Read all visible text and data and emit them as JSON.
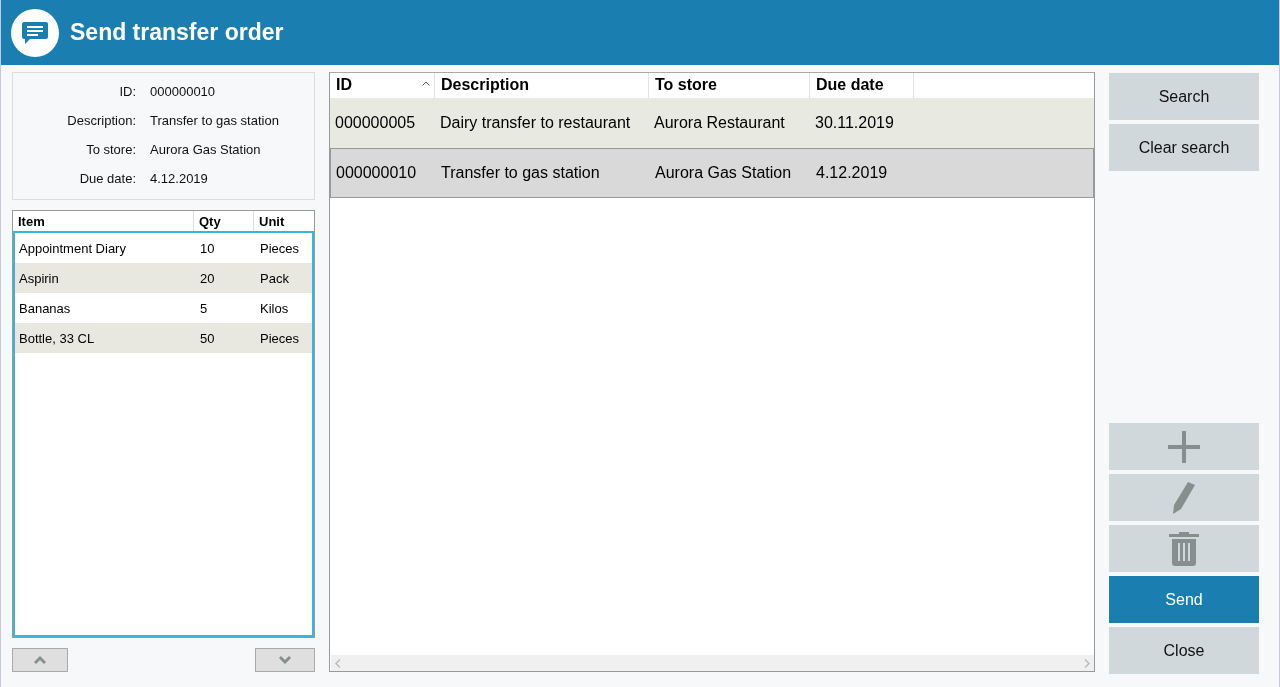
{
  "window": {
    "title": "Send transfer order"
  },
  "details": [
    {
      "label": "ID:",
      "value": "000000010"
    },
    {
      "label": "Description:",
      "value": "Transfer to gas station"
    },
    {
      "label": "To store:",
      "value": "Aurora Gas Station"
    },
    {
      "label": "Due date:",
      "value": "4.12.2019"
    }
  ],
  "items": {
    "columns": [
      "Item",
      "Qty",
      "Unit"
    ],
    "rows": [
      [
        "Appointment Diary",
        "10",
        "Pieces"
      ],
      [
        "Aspirin",
        "20",
        "Pack"
      ],
      [
        "Bananas",
        "5",
        "Kilos"
      ],
      [
        "Bottle, 33 CL",
        "50",
        "Pieces"
      ]
    ]
  },
  "orders": {
    "columns": [
      {
        "label": "ID",
        "sorted": true
      },
      {
        "label": "Description",
        "sorted": false
      },
      {
        "label": "To store",
        "sorted": false
      },
      {
        "label": "Due date",
        "sorted": false
      }
    ],
    "rows": [
      {
        "cells": [
          "000000005",
          "Dairy transfer to restaurant",
          "Aurora Restaurant",
          "30.11.2019"
        ],
        "selected": false
      },
      {
        "cells": [
          "000000010",
          "Transfer to gas station",
          "Aurora Gas Station",
          "4.12.2019"
        ],
        "selected": true
      }
    ]
  },
  "actions": [
    {
      "kind": "text",
      "label": "Search"
    },
    {
      "kind": "text",
      "label": "Clear search"
    }
  ],
  "tools": [
    {
      "kind": "add"
    },
    {
      "kind": "edit"
    },
    {
      "kind": "delete"
    },
    {
      "kind": "primary",
      "label": "Send"
    },
    {
      "kind": "text",
      "label": "Close"
    }
  ]
}
